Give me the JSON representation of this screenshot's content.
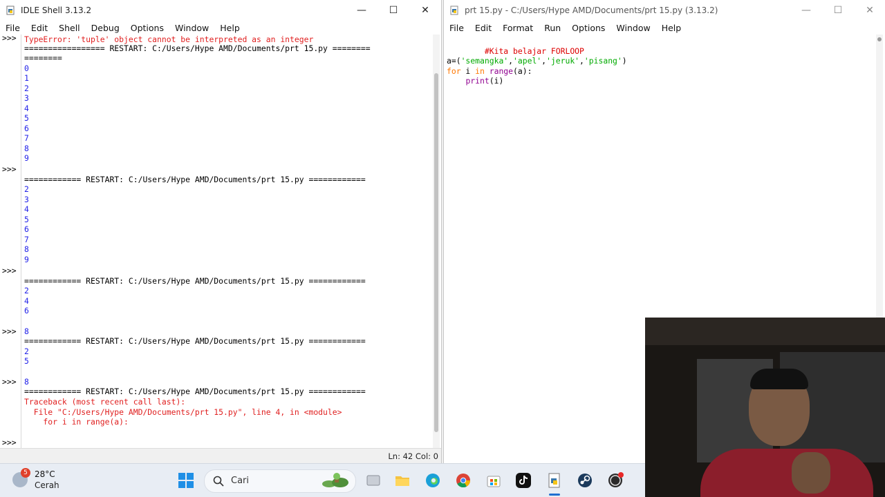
{
  "shell_window": {
    "title": "IDLE Shell 3.13.2",
    "menu": [
      "File",
      "Edit",
      "Shell",
      "Debug",
      "Options",
      "Window",
      "Help"
    ],
    "status": "Ln: 42  Col: 0",
    "prompts": [
      ">>>",
      ">>>",
      ">>>",
      ">>>",
      ">>>",
      ">>>"
    ],
    "lines": [
      {
        "text": "================= RESTART: C:/Users/Hype AMD/Documents/prt 15.py ========",
        "kind": "sep"
      },
      {
        "text": "========",
        "kind": "sep"
      },
      {
        "text": "0",
        "kind": "num"
      },
      {
        "text": "1",
        "kind": "num"
      },
      {
        "text": "2",
        "kind": "num"
      },
      {
        "text": "3",
        "kind": "num"
      },
      {
        "text": "4",
        "kind": "num"
      },
      {
        "text": "5",
        "kind": "num"
      },
      {
        "text": "6",
        "kind": "num"
      },
      {
        "text": "7",
        "kind": "num"
      },
      {
        "text": "8",
        "kind": "num"
      },
      {
        "text": "9",
        "kind": "num"
      },
      {
        "text": "============ RESTART: C:/Users/Hype AMD/Documents/prt 15.py ============",
        "kind": "sep"
      },
      {
        "text": "2",
        "kind": "num"
      },
      {
        "text": "3",
        "kind": "num"
      },
      {
        "text": "4",
        "kind": "num"
      },
      {
        "text": "5",
        "kind": "num"
      },
      {
        "text": "6",
        "kind": "num"
      },
      {
        "text": "7",
        "kind": "num"
      },
      {
        "text": "8",
        "kind": "num"
      },
      {
        "text": "9",
        "kind": "num"
      },
      {
        "text": "============ RESTART: C:/Users/Hype AMD/Documents/prt 15.py ============",
        "kind": "sep"
      },
      {
        "text": "2",
        "kind": "num"
      },
      {
        "text": "4",
        "kind": "num"
      },
      {
        "text": "6",
        "kind": "num"
      },
      {
        "text": "8",
        "kind": "num"
      },
      {
        "text": "============ RESTART: C:/Users/Hype AMD/Documents/prt 15.py ============",
        "kind": "sep"
      },
      {
        "text": "2",
        "kind": "num"
      },
      {
        "text": "5",
        "kind": "num"
      },
      {
        "text": "8",
        "kind": "num"
      },
      {
        "text": "============ RESTART: C:/Users/Hype AMD/Documents/prt 15.py ============",
        "kind": "sep"
      },
      {
        "text": "Traceback (most recent call last):",
        "kind": "err"
      },
      {
        "text": "  File \"C:/Users/Hype AMD/Documents/prt 15.py\", line 4, in <module>",
        "kind": "err"
      },
      {
        "text": "    for i in range(a):",
        "kind": "err"
      },
      {
        "text": "TypeError: 'tuple' object cannot be interpreted as an integer",
        "kind": "err"
      }
    ]
  },
  "editor_window": {
    "title": "prt 15.py - C:/Users/Hype AMD/Documents/prt 15.py (3.13.2)",
    "menu": [
      "File",
      "Edit",
      "Format",
      "Run",
      "Options",
      "Window",
      "Help"
    ],
    "code": {
      "comment": "#Kita belajar FORLOOP",
      "l2_a": "a=(",
      "l2_s1": "'semangka'",
      "l2_c1": ",",
      "l2_s2": "'apel'",
      "l2_c2": ",",
      "l2_s3": "'jeruk'",
      "l2_c3": ",",
      "l2_s4": "'pisang'",
      "l2_end": ")",
      "l3_for": "for",
      "l3_i": " i ",
      "l3_in": "in",
      "l3_sp": " ",
      "l3_range": "range",
      "l3_rest": "(a):",
      "l4_indent": "    ",
      "l4_print": "print",
      "l4_rest": "(i)"
    }
  },
  "taskbar": {
    "weather_badge": "5",
    "temperature": "28°C",
    "condition": "Cerah",
    "search_label": "Cari"
  }
}
